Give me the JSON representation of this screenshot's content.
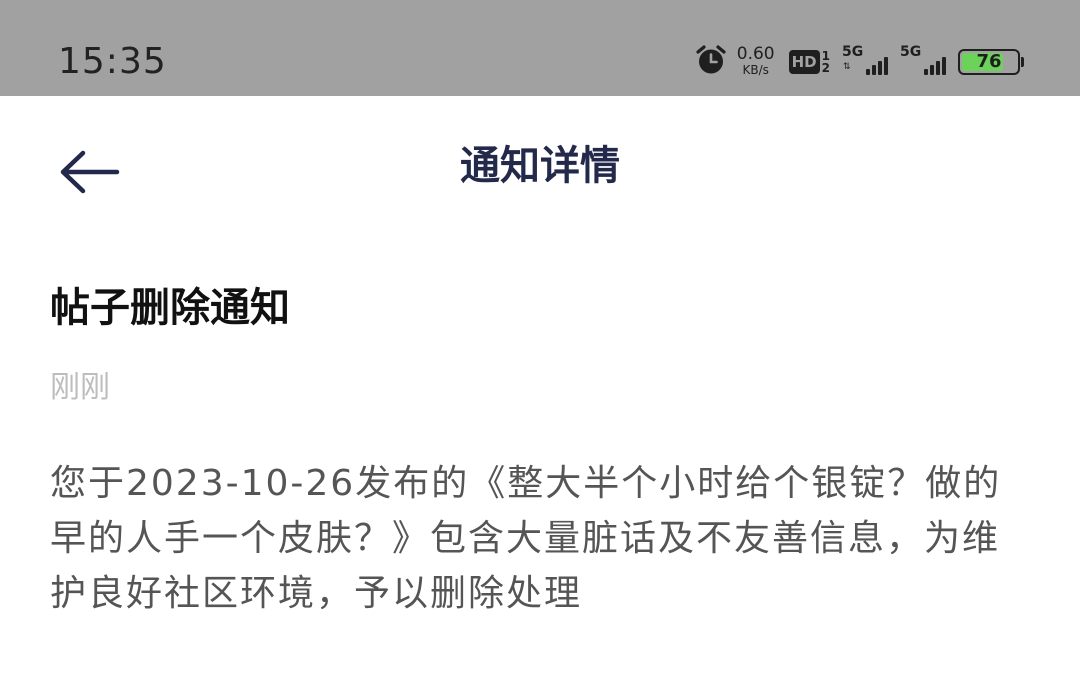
{
  "status_bar": {
    "time": "15:35",
    "net_speed_value": "0.60",
    "net_speed_unit": "KB/s",
    "hd_label": "HD",
    "hd_sim1": "1",
    "hd_sim2": "2",
    "sim1_network": "5G",
    "sim2_network": "5G",
    "battery_level": "76",
    "battery_fraction": 0.76,
    "battery_color": "#6cd35a"
  },
  "nav": {
    "title": "通知详情"
  },
  "notice": {
    "title": "帖子删除通知",
    "time": "刚刚",
    "body": "您于2023-10-26发布的《整大半个小时给个银锭？做的早的人手一个皮肤？》包含大量脏话及不友善信息，为维护良好社区环境，予以删除处理"
  },
  "icons": {
    "alarm": "alarm-clock-icon",
    "back": "arrow-left-icon"
  }
}
